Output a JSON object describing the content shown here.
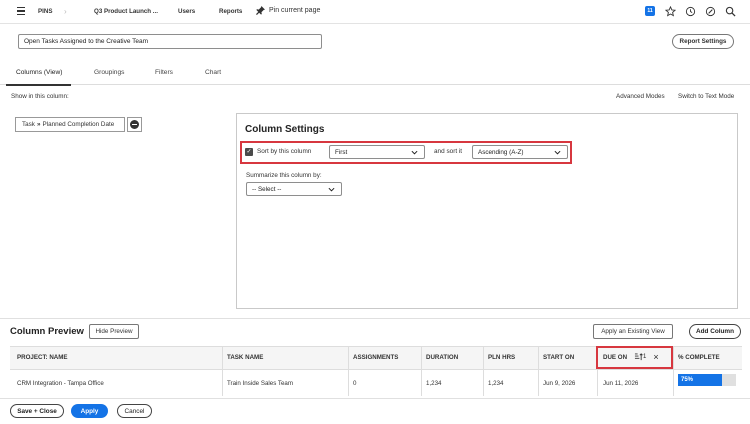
{
  "nav": {
    "section": "PINS",
    "report_name": "Q3 Product Launch ...",
    "users": "Users",
    "reports": "Reports",
    "pin": "Pin current page",
    "badge": "11"
  },
  "report": {
    "title_value": "Open Tasks Assigned to the Creative Team",
    "settings_button": "Report Settings"
  },
  "tabs": [
    {
      "label": "Columns (View)",
      "active": true
    },
    {
      "label": "Groupings",
      "active": false
    },
    {
      "label": "Filters",
      "active": false
    },
    {
      "label": "Chart",
      "active": false
    }
  ],
  "column_area": {
    "show_label": "Show in this column:",
    "advanced_modes": "Advanced Modes",
    "switch_text_mode": "Switch to Text Mode",
    "chip_object": "Task",
    "chip_sep": "»",
    "chip_field": "Planned Completion Date"
  },
  "column_settings": {
    "title": "Column Settings",
    "sort_checked": true,
    "sort_label": "Sort by this column",
    "sort_order_value": "First",
    "and_sort_label": "and sort it",
    "sort_direction_value": "Ascending (A-Z)",
    "summarize_label": "Summarize this column by:",
    "summarize_value": "-- Select --"
  },
  "preview": {
    "title": "Column Preview",
    "hide_button": "Hide Preview",
    "apply_view_button": "Apply an Existing View",
    "add_column_button": "Add Column",
    "columns": [
      "PROJECT: NAME",
      "TASK NAME",
      "ASSIGNMENTS",
      "DURATION",
      "PLN HRS",
      "START ON",
      "DUE ON",
      "% COMPLETE"
    ],
    "sort_indicator": "1",
    "row": {
      "project": "CRM Integration - Tampa Office",
      "task": "Train Inside Sales Team",
      "assignments": "0",
      "duration": "1,234",
      "pln_hrs": "1,234",
      "start_on": "Jun 9, 2026",
      "due_on": "Jun 11, 2026",
      "percent_complete": "75%",
      "percent_value": 0.75
    }
  },
  "footer": {
    "save_close": "Save + Close",
    "apply": "Apply",
    "cancel": "Cancel"
  },
  "colors": {
    "accent": "#1473e6",
    "highlight": "#d7373f"
  }
}
